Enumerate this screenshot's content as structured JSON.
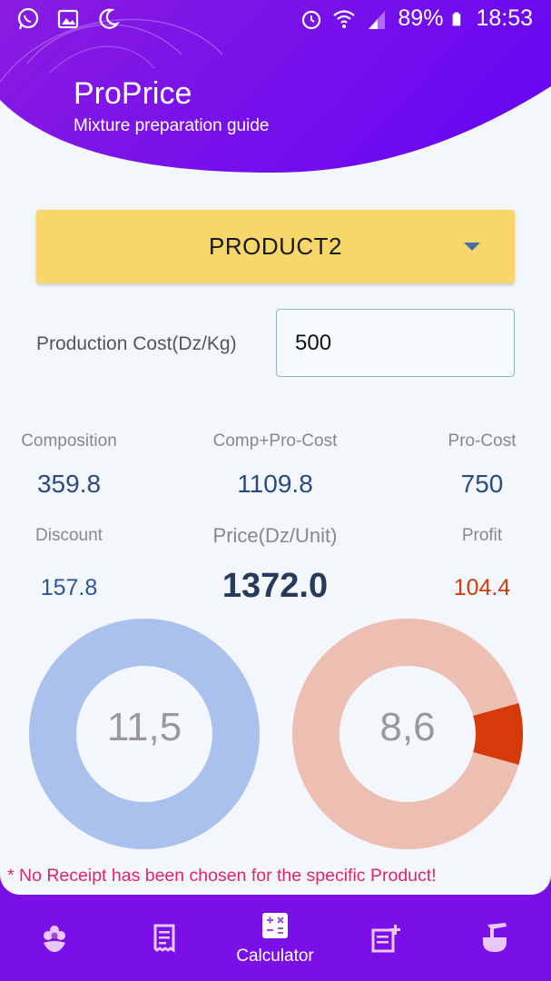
{
  "status_bar": {
    "battery": "89%",
    "time": "18:53",
    "icons_left": [
      "whatsapp-icon",
      "gallery-icon",
      "moon-icon"
    ],
    "icons_right": [
      "alarm-icon",
      "wifi-icon",
      "signal-icon",
      "battery-icon"
    ]
  },
  "header": {
    "title": "ProPrice",
    "subtitle": "Mixture preparation guide"
  },
  "product_select": {
    "selected": "PRODUCT2"
  },
  "production_cost": {
    "label": "Production Cost(Dz/Kg)",
    "value": "500"
  },
  "stats": {
    "composition": {
      "label": "Composition",
      "value": "359.8"
    },
    "comp_pro_cost": {
      "label": "Comp+Pro-Cost",
      "value": "1109.8"
    },
    "pro_cost": {
      "label": "Pro-Cost",
      "value": "750"
    },
    "discount": {
      "label": "Discount",
      "value": "157.8"
    },
    "price": {
      "label": "Price(Dz/Unit)",
      "value": "1372.0"
    },
    "profit": {
      "label": "Profit",
      "value": "104.4"
    }
  },
  "donuts": {
    "left": {
      "center_text": "11,5",
      "fraction": 1.0,
      "color": "#aac1ee"
    },
    "right": {
      "center_text": "8,6",
      "fraction": 0.086,
      "base_color": "#ecbfb2",
      "accent_color": "#d63a08"
    }
  },
  "warning": "* No Receipt has been chosen for the specific Product!",
  "nav": {
    "items": [
      {
        "icon": "flower-icon",
        "label": ""
      },
      {
        "icon": "receipt-icon",
        "label": ""
      },
      {
        "icon": "calculator-icon",
        "label": "Calculator"
      },
      {
        "icon": "note-add-icon",
        "label": ""
      },
      {
        "icon": "mortar-icon",
        "label": ""
      }
    ]
  },
  "colors": {
    "brand_purple": "#7a0fe8",
    "nav_purple": "#9c4fd6",
    "dropdown_yellow": "#f7d76a"
  }
}
